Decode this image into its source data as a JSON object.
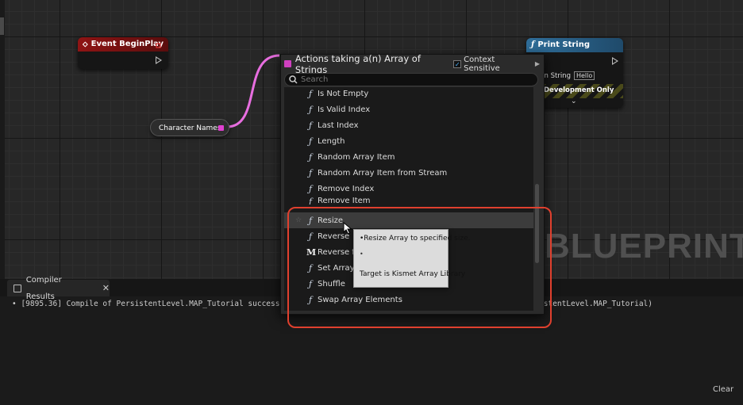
{
  "graph": {
    "watermark": "BLUEPRINT",
    "nodes": {
      "event_begin_play": {
        "title": "Event BeginPlay",
        "header_color": "#8f1414"
      },
      "print_string": {
        "title": "Print String",
        "header_color": "#2f6e9a",
        "in_string_label": "In String",
        "in_string_value": "Hello",
        "dev_only_label": "Development Only"
      },
      "character_names": {
        "label": "Character Names",
        "pin_color": "#e040d0"
      }
    },
    "wire_color": "#e86ee0"
  },
  "action_menu": {
    "title": "Actions taking a(n) Array of Strings",
    "context_sensitive_label": "Context Sensitive",
    "context_sensitive_checked": true,
    "search_placeholder": "Search",
    "items": [
      {
        "label": "Is Not Empty",
        "icon": "function-icon"
      },
      {
        "label": "Is Valid Index",
        "icon": "function-icon"
      },
      {
        "label": "Last Index",
        "icon": "function-icon"
      },
      {
        "label": "Length",
        "icon": "function-icon"
      },
      {
        "label": "Random Array Item",
        "icon": "function-icon"
      },
      {
        "label": "Random Array Item from Stream",
        "icon": "function-icon"
      },
      {
        "label": "Remove Index",
        "icon": "function-icon"
      },
      {
        "label": "Remove Item",
        "icon": "function-icon"
      },
      {
        "label": "Resize",
        "icon": "function-icon"
      },
      {
        "label": "Reverse",
        "icon": "function-icon"
      },
      {
        "label": "Reverse for Each Loop",
        "icon": "macro-icon"
      },
      {
        "label": "Set Array Elem",
        "icon": "function-icon"
      },
      {
        "label": "Shuffle",
        "icon": "function-icon"
      },
      {
        "label": "Swap Array Elements",
        "icon": "function-icon"
      }
    ],
    "highlighted_item": "Resize"
  },
  "tooltip": {
    "line1": "•Resize Array to specified size.",
    "line2": "Target is Kismet Array Library"
  },
  "compiler_panel": {
    "tab_label": "Compiler Results",
    "log_text": "[9895.36] Compile of PersistentLevel.MAP_Tutorial success",
    "log_tail": "istentLevel.MAP_Tutorial)",
    "clear_label": "Clear"
  },
  "highlight_box_color": "#e0402e"
}
